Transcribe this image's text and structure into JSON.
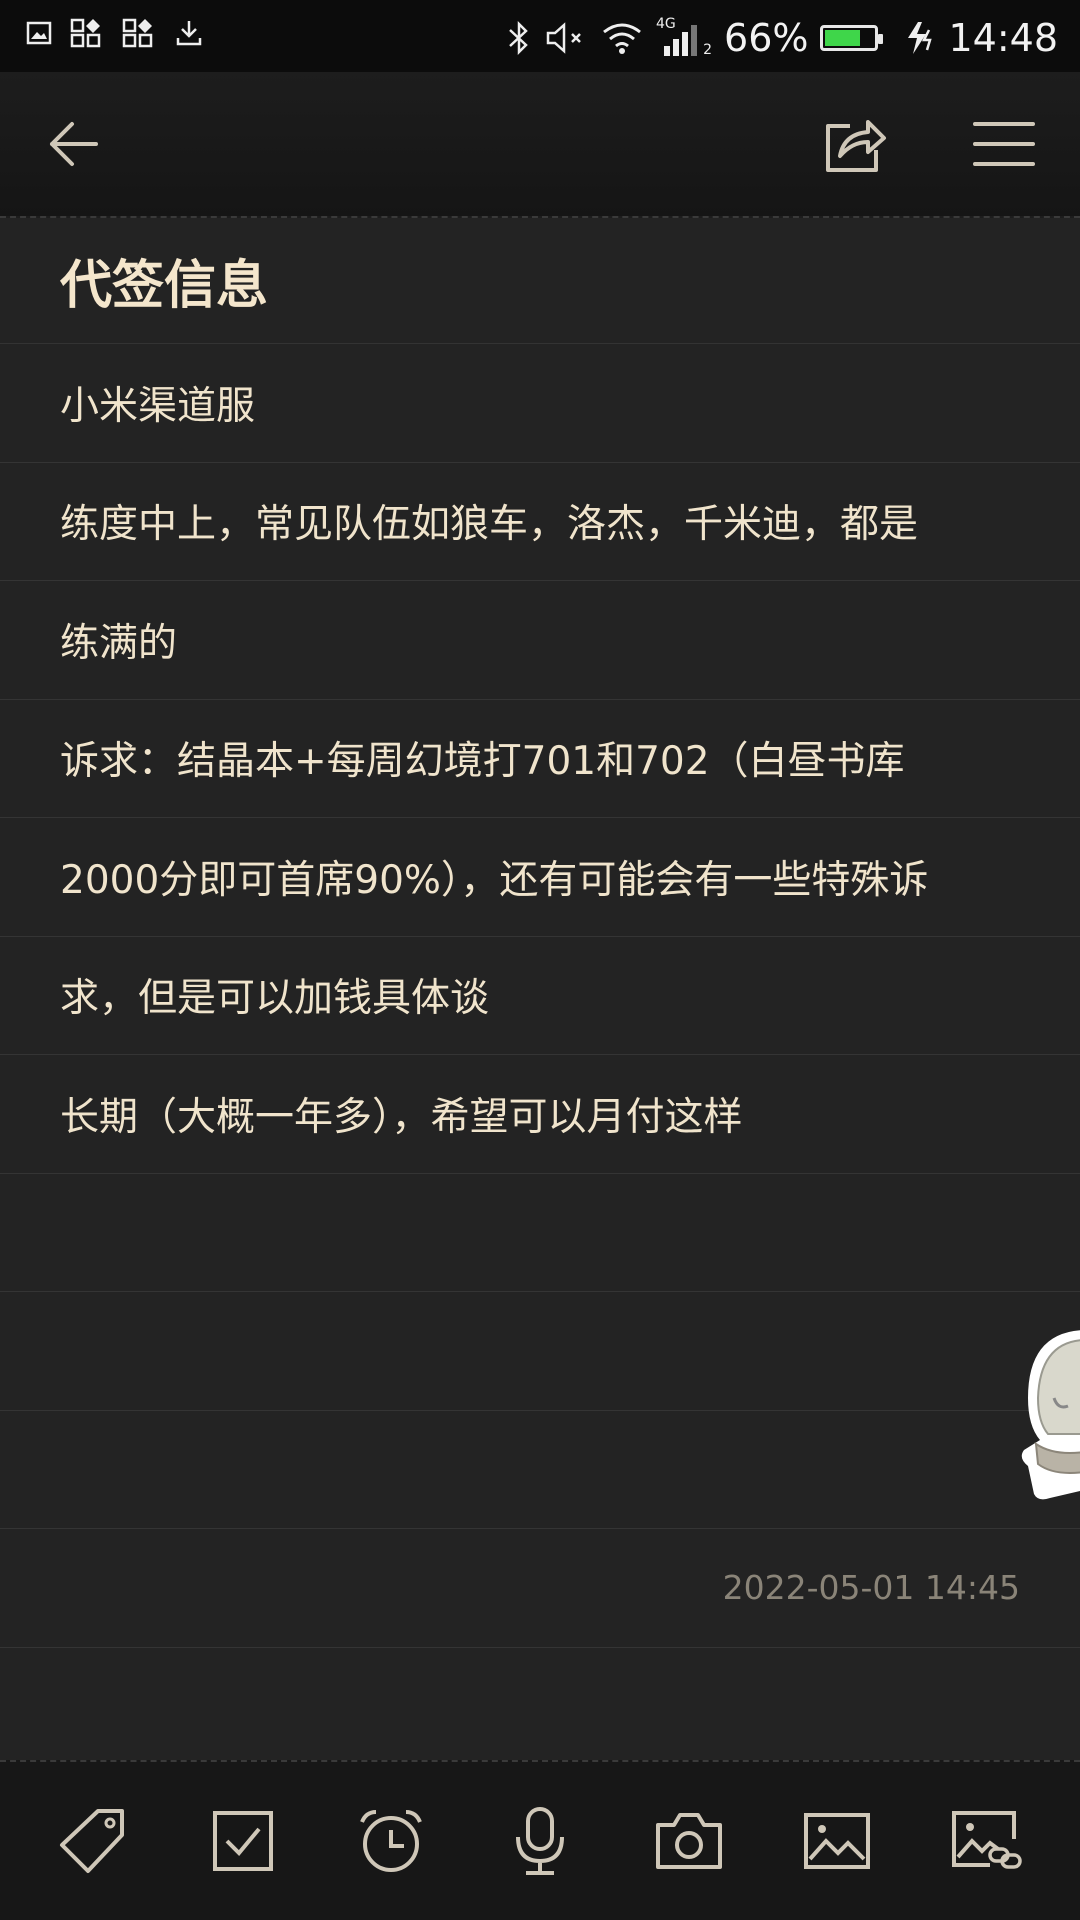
{
  "status_bar": {
    "battery_text": "66%",
    "battery_level": 0.66,
    "network_label": "4G",
    "sim_slot": "2",
    "time": "14:48"
  },
  "toolbar": {
    "back_icon": "back-arrow-icon",
    "share_icon": "share-icon",
    "menu_icon": "menu-icon"
  },
  "note": {
    "title": "代签信息",
    "lines": [
      "小米渠道服",
      "练度中上，常见队伍如狼车，洛杰，千米迪，都是",
      "练满的",
      "诉求：结晶本+每周幻境打701和702（白昼书库",
      "2000分即可首席90%），还有可能会有一些特殊诉",
      "求，但是可以加钱具体谈",
      "长期（大概一年多），希望可以月付这样",
      "",
      "",
      ""
    ],
    "timestamp": "2022-05-01 14:45"
  },
  "bottom_bar": {
    "icons": [
      "tag-icon",
      "checkbox-icon",
      "alarm-icon",
      "microphone-icon",
      "camera-icon",
      "image-icon",
      "image-link-icon"
    ]
  },
  "colors": {
    "background": "#232323",
    "text": "#f0e4cc",
    "battery": "#3fd64a"
  }
}
